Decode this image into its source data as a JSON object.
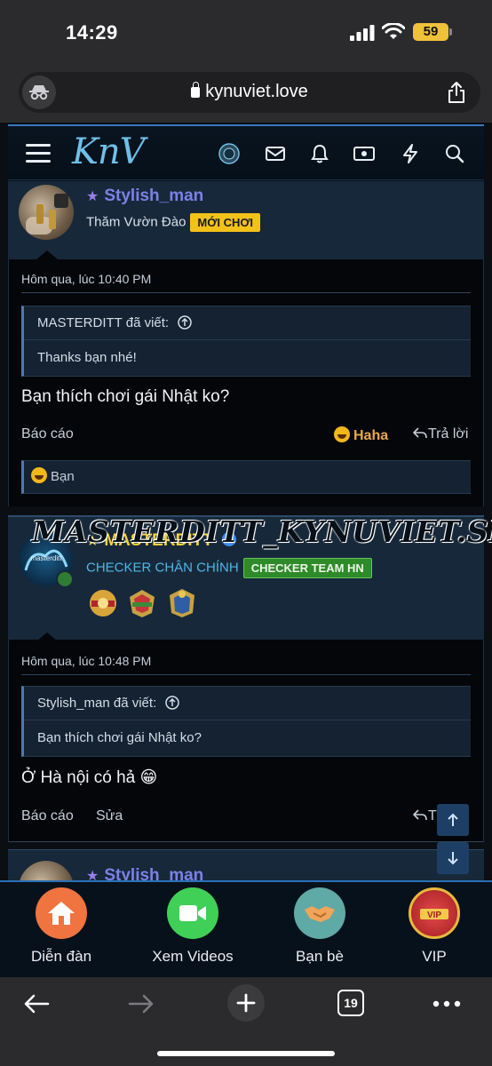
{
  "status": {
    "time": "14:29",
    "battery": "59"
  },
  "browser": {
    "url": "kynuviet.love",
    "tab_count": "19"
  },
  "site": {
    "logo": "KnV"
  },
  "posts": [
    {
      "username": "Stylish_man",
      "user_title": "Thăm Vườn Đào",
      "badge": "MỚI CHƠI",
      "date": "Hôm qua, lúc 10:40 PM",
      "quote_author": "MASTERDITT đã viết:",
      "quote_text": "Thanks bạn nhé!",
      "message": "Bạn thích chơi gái Nhật ko?",
      "report": "Báo cáo",
      "reaction": "Haha",
      "reply": "Trả lời",
      "reacted_by": "Bạn"
    },
    {
      "username": "MASTERDITT",
      "user_title": "CHECKER CHÂN CHÍNH",
      "badge": "CHECKER TEAM HN",
      "avatar_text": "masterditt",
      "date": "Hôm qua, lúc 10:48 PM",
      "quote_author": "Stylish_man đã viết:",
      "quote_text": "Bạn thích chơi gái Nhật ko?",
      "message": "Ở Hà nội có hả 😁",
      "report": "Báo cáo",
      "edit": "Sửa",
      "reply": "Trả lời"
    },
    {
      "username": "Stylish_man"
    }
  ],
  "watermark": "MASTERDITT_KYNUVIET.SITE",
  "bottom_nav": [
    {
      "label": "Diễn đàn",
      "icon": "home-icon",
      "color": "#f0743e"
    },
    {
      "label": "Xem Videos",
      "icon": "video-icon",
      "color": "#3fcf56"
    },
    {
      "label": "Bạn bè",
      "icon": "handshake-icon",
      "color": "#5fa9a6"
    },
    {
      "label": "VIP",
      "icon": "vip-medal-icon",
      "color": "#d7363a"
    }
  ]
}
